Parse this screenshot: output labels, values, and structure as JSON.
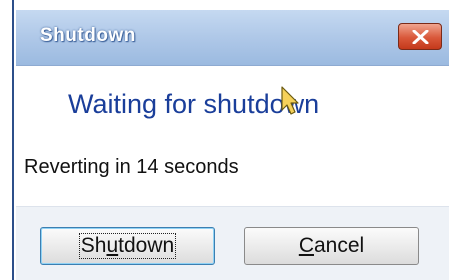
{
  "dialog": {
    "title": "Shutdown",
    "heading": "Waiting for shutdown",
    "status": "Reverting in 14 seconds",
    "close_icon": "close-icon",
    "close_color": "#d9583a",
    "buttons": {
      "shutdown": {
        "before": "Sh",
        "accel": "u",
        "after": "tdown"
      },
      "cancel": {
        "before": "",
        "accel": "C",
        "after": "ancel"
      }
    }
  },
  "colors": {
    "heading": "#1a3e9a",
    "titlebar": "#afc8e8"
  }
}
